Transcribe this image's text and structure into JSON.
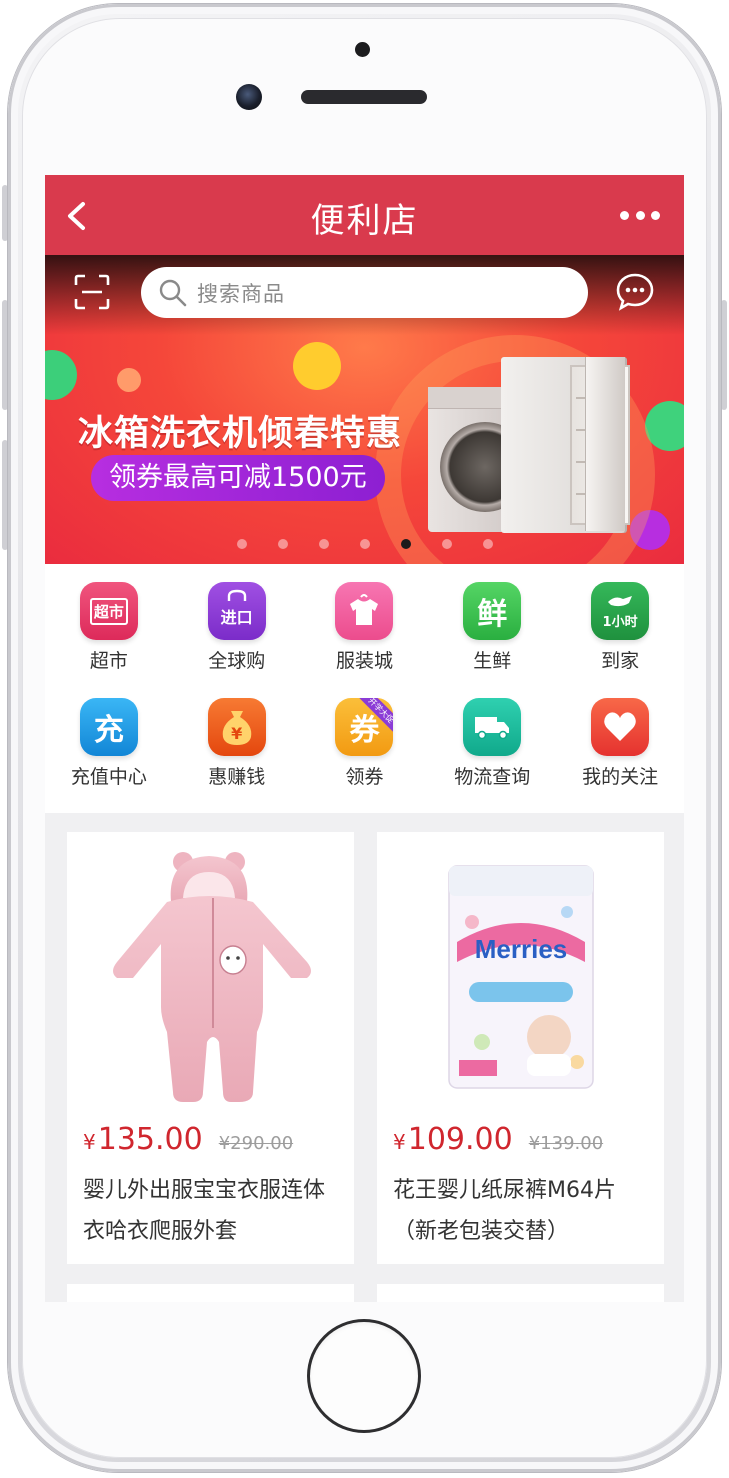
{
  "navbar": {
    "title": "便利店",
    "back_icon": "chevron-left-icon",
    "more_icon": "more-dots-icon",
    "bg_color": "#d93a4d"
  },
  "search": {
    "placeholder": "搜索商品",
    "scan_icon": "scan-icon",
    "message_icon": "chat-bubble-icon"
  },
  "banner": {
    "headline": "冰箱洗衣机倾春特惠",
    "subline": "领券最高可减1500元",
    "slides_total": 7,
    "active_slide": 5
  },
  "menu": {
    "items": [
      {
        "label": "超市",
        "icon": "supermarket-cart-icon",
        "glyph": "超市",
        "color": "#e8386a"
      },
      {
        "label": "全球购",
        "icon": "global-import-bag-icon",
        "glyph": "进口",
        "color": "#8b3cd6"
      },
      {
        "label": "服装城",
        "icon": "clothing-shirt-icon",
        "glyph": "",
        "color": "#f25b9e"
      },
      {
        "label": "生鲜",
        "icon": "fresh-food-icon",
        "glyph": "鲜",
        "color": "#3bbf4f"
      },
      {
        "label": "到家",
        "icon": "delivery-1hour-icon",
        "glyph": "1小时",
        "color": "#2aa14d"
      },
      {
        "label": "充值中心",
        "icon": "recharge-icon",
        "glyph": "充",
        "color": "#1e9fe8"
      },
      {
        "label": "惠赚钱",
        "icon": "money-bag-icon",
        "glyph": "¥",
        "color": "#f05a22"
      },
      {
        "label": "领券",
        "icon": "coupon-icon",
        "glyph": "券",
        "color": "#f6a71c",
        "badge": "开学大促"
      },
      {
        "label": "物流查询",
        "icon": "logistics-truck-icon",
        "glyph": "",
        "color": "#16b79a"
      },
      {
        "label": "我的关注",
        "icon": "heart-follow-icon",
        "glyph": "",
        "color": "#ef4a3c"
      }
    ]
  },
  "products": [
    {
      "price_symbol": "¥",
      "price": "135.00",
      "original_price": "¥290.00",
      "title": "婴儿外出服宝宝衣服连体衣哈衣爬服外套",
      "image": "pink-baby-romper-image"
    },
    {
      "price_symbol": "¥",
      "price": "109.00",
      "original_price": "¥139.00",
      "title": "花王婴儿纸尿裤M64片（新老包装交替）",
      "image": "merries-diaper-pack-image",
      "brand_text": "Merries"
    }
  ],
  "colors": {
    "price": "#d0262e",
    "accent": "#d93a4d"
  }
}
